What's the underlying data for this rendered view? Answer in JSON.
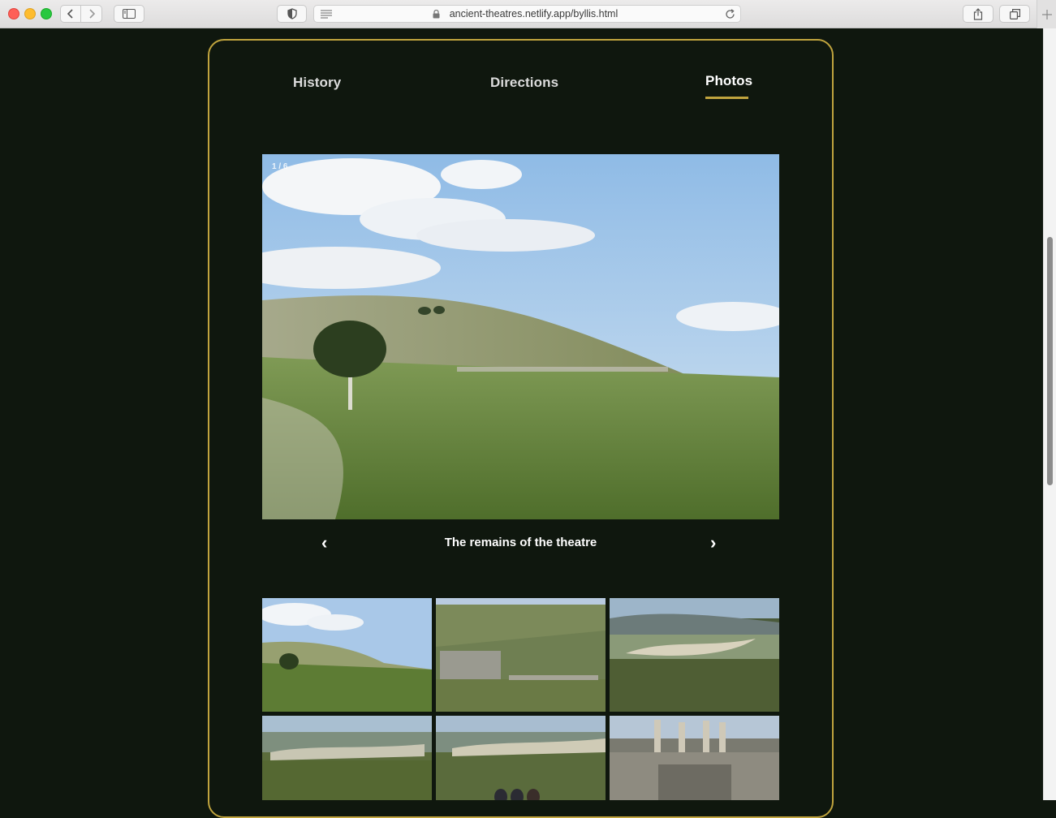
{
  "browser": {
    "url": "ancient-theatres.netlify.app/byllis.html"
  },
  "tabs": [
    {
      "label": "History",
      "active": false
    },
    {
      "label": "Directions",
      "active": false
    },
    {
      "label": "Photos",
      "active": true
    }
  ],
  "gallery": {
    "counter": "1 / 6",
    "caption": "The remains of the theatre",
    "prev_arrow": "‹",
    "next_arrow": "›"
  },
  "colors": {
    "page_background": "#0f170e",
    "accent_gold": "#c0a43e"
  }
}
